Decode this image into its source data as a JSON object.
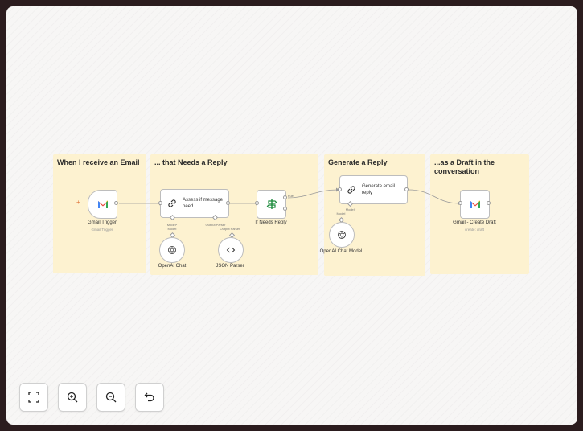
{
  "stickies": [
    {
      "title": "When I receive an Email"
    },
    {
      "title": "... that Needs a Reply"
    },
    {
      "title": "Generate a Reply"
    },
    {
      "title": "...as a Draft in the conversation"
    }
  ],
  "nodes": {
    "gmail_trigger": {
      "label": "Gmail Trigger",
      "sublabel": "Gmail Trigger"
    },
    "assess": {
      "label": "Assess if message need..."
    },
    "if_needs_reply": {
      "label": "If Needs Reply",
      "true_label": "true"
    },
    "generate": {
      "label": "Generate email reply"
    },
    "gmail_draft": {
      "label": "Gmail - Create Draft",
      "sublabel": "create: draft"
    },
    "openai_chat": {
      "label": "OpenAI Chat"
    },
    "json_parser": {
      "label": "JSON Parser"
    },
    "openai_chat_model": {
      "label": "OpenAI Chat Model"
    }
  },
  "ports": {
    "assess_model": "Model*",
    "assess_model_sub": "Model",
    "assess_output": "Output Parser",
    "assess_output_sub": "Output Parser",
    "generate_model": "Model*",
    "generate_model_sub": "Model"
  },
  "colors": {
    "sticky": "#fdf2d0",
    "gmail_red": "#ea4335",
    "if_green": "#1a8a3a"
  },
  "controls": [
    "fit-view-icon",
    "zoom-in-icon",
    "zoom-out-icon",
    "undo-icon"
  ]
}
